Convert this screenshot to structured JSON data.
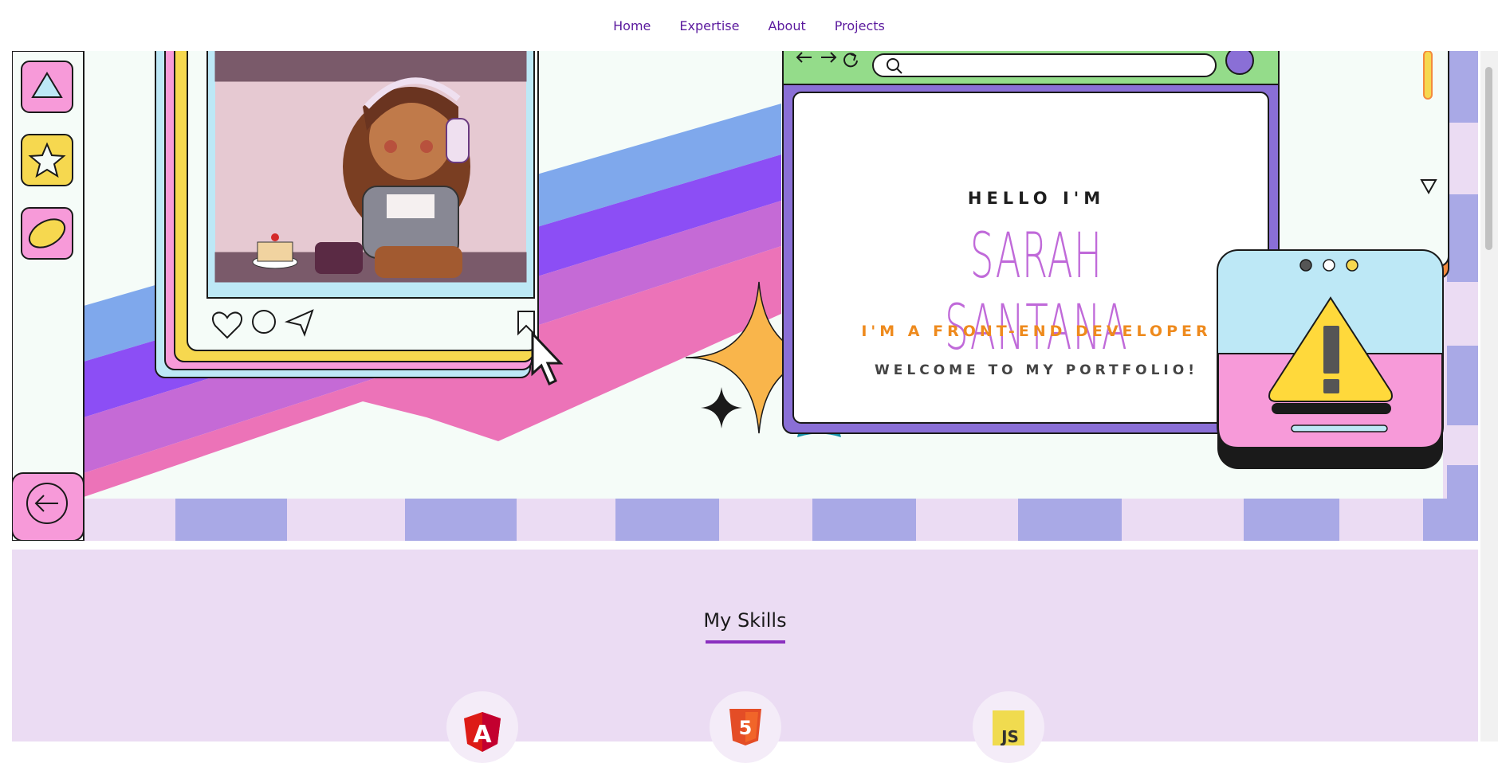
{
  "nav": {
    "items": [
      "Home",
      "Expertise",
      "About",
      "Projects"
    ]
  },
  "hero": {
    "greeting": "HELLO I'M",
    "name": "SARAH SANTANA",
    "role": "I'M A FRONT-END DEVELOPER",
    "welcome": "WELCOME TO MY PORTFOLIO!"
  },
  "skills": {
    "title": "My Skills",
    "items": [
      {
        "icon": "angular-icon",
        "glyph": "A"
      },
      {
        "icon": "html5-icon",
        "glyph": "5"
      },
      {
        "icon": "javascript-icon",
        "glyph": "JS"
      }
    ]
  },
  "colors": {
    "nav_text": "#5b1a9e",
    "accent_purple": "#8a2fbf",
    "name_pink": "#c06ad9",
    "role_orange": "#ee8a1d",
    "section_bg": "#ebdcf3"
  }
}
